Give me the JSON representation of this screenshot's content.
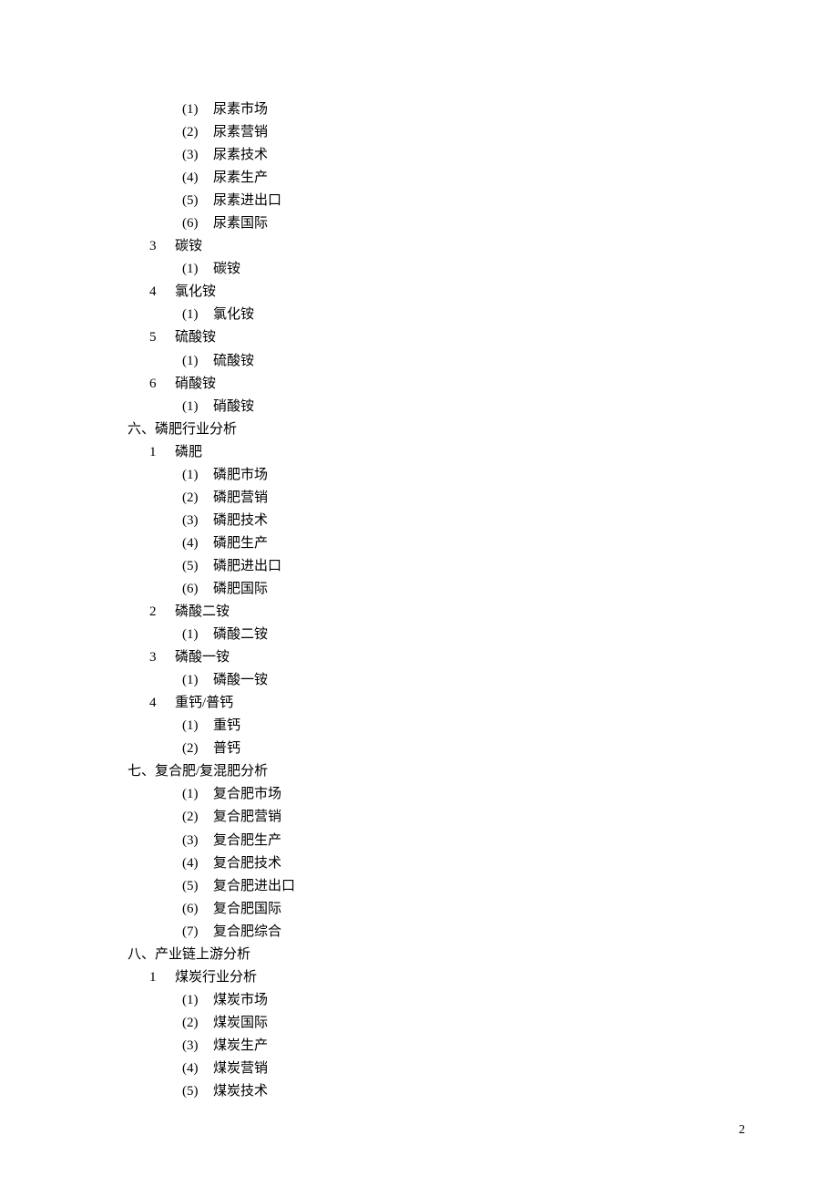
{
  "page_number": "2",
  "lines": [
    {
      "level": 3,
      "num": "(1)",
      "text": "尿素市场"
    },
    {
      "level": 3,
      "num": "(2)",
      "text": "尿素营销"
    },
    {
      "level": 3,
      "num": "(3)",
      "text": "尿素技术"
    },
    {
      "level": 3,
      "num": "(4)",
      "text": "尿素生产"
    },
    {
      "level": 3,
      "num": "(5)",
      "text": "尿素进出口"
    },
    {
      "level": 3,
      "num": "(6)",
      "text": "尿素国际"
    },
    {
      "level": 2,
      "num": "3",
      "text": "碳铵"
    },
    {
      "level": 3,
      "num": "(1)",
      "text": "碳铵"
    },
    {
      "level": 2,
      "num": "4",
      "text": "氯化铵"
    },
    {
      "level": 3,
      "num": "(1)",
      "text": "氯化铵"
    },
    {
      "level": 2,
      "num": "5",
      "text": "硫酸铵"
    },
    {
      "level": 3,
      "num": "(1)",
      "text": "硫酸铵"
    },
    {
      "level": 2,
      "num": "6",
      "text": "硝酸铵"
    },
    {
      "level": 3,
      "num": "(1)",
      "text": "硝酸铵"
    },
    {
      "level": 1,
      "num": "六、",
      "text": "磷肥行业分析"
    },
    {
      "level": 2,
      "num": "1",
      "text": "磷肥"
    },
    {
      "level": 3,
      "num": "(1)",
      "text": "磷肥市场"
    },
    {
      "level": 3,
      "num": "(2)",
      "text": "磷肥营销"
    },
    {
      "level": 3,
      "num": "(3)",
      "text": "磷肥技术"
    },
    {
      "level": 3,
      "num": "(4)",
      "text": "磷肥生产"
    },
    {
      "level": 3,
      "num": "(5)",
      "text": "磷肥进出口"
    },
    {
      "level": 3,
      "num": "(6)",
      "text": "磷肥国际"
    },
    {
      "level": 2,
      "num": "2",
      "text": "磷酸二铵"
    },
    {
      "level": 3,
      "num": "(1)",
      "text": "磷酸二铵"
    },
    {
      "level": 2,
      "num": "3",
      "text": "磷酸一铵"
    },
    {
      "level": 3,
      "num": "(1)",
      "text": "磷酸一铵"
    },
    {
      "level": 2,
      "num": "4",
      "text": "重钙/普钙"
    },
    {
      "level": 3,
      "num": "(1)",
      "text": "重钙"
    },
    {
      "level": 3,
      "num": "(2)",
      "text": "普钙"
    },
    {
      "level": 1,
      "num": "七、",
      "text": "复合肥/复混肥分析"
    },
    {
      "level": 3,
      "num": "(1)",
      "text": "复合肥市场"
    },
    {
      "level": 3,
      "num": "(2)",
      "text": "复合肥营销"
    },
    {
      "level": 3,
      "num": "(3)",
      "text": "复合肥生产"
    },
    {
      "level": 3,
      "num": "(4)",
      "text": "复合肥技术"
    },
    {
      "level": 3,
      "num": "(5)",
      "text": "复合肥进出口"
    },
    {
      "level": 3,
      "num": "(6)",
      "text": "复合肥国际"
    },
    {
      "level": 3,
      "num": "(7)",
      "text": "复合肥综合"
    },
    {
      "level": 1,
      "num": "八、",
      "text": "产业链上游分析"
    },
    {
      "level": 2,
      "num": "1",
      "text": "煤炭行业分析"
    },
    {
      "level": 3,
      "num": "(1)",
      "text": "煤炭市场"
    },
    {
      "level": 3,
      "num": "(2)",
      "text": "煤炭国际"
    },
    {
      "level": 3,
      "num": "(3)",
      "text": "煤炭生产"
    },
    {
      "level": 3,
      "num": "(4)",
      "text": "煤炭营销"
    },
    {
      "level": 3,
      "num": "(5)",
      "text": "煤炭技术"
    }
  ]
}
